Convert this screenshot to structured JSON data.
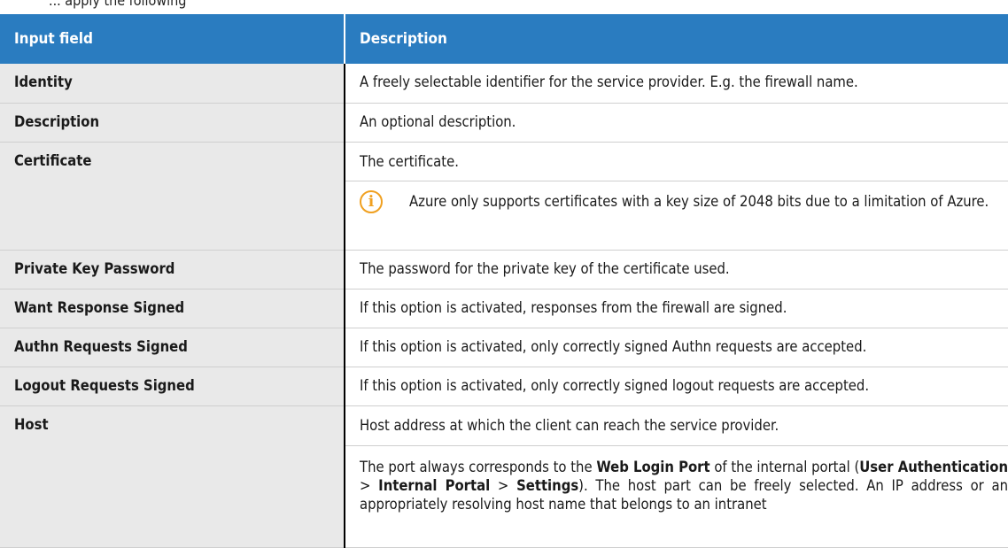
{
  "header_cut_text": "... apply the following",
  "columns": [
    "Input field",
    "Description"
  ],
  "rows": [
    {
      "label": "Identity",
      "desc": "A freely selectable identifier for the service provider. E.g. the firewall name."
    },
    {
      "label": "Description",
      "desc": "An optional description."
    },
    {
      "label": "Certificate",
      "desc": "The certificate.",
      "note_icon": "info-icon",
      "note": "Azure only supports certificates with a key size of 2048 bits due to a limitation of Azure."
    },
    {
      "label": "Private Key Password",
      "desc": "The password for the private key of the certificate used."
    },
    {
      "label": "Want Response Signed",
      "desc": "If this option is activated, responses from the firewall are signed."
    },
    {
      "label": "Authn Requests Signed",
      "desc": "If this option is activated, only correctly signed Authn requests are accepted."
    },
    {
      "label": "Logout Requests Signed",
      "desc": "If this option is activated, only correctly signed logout requests are accepted."
    },
    {
      "label": "Host",
      "desc": "Host address at which the client can reach the service provider.",
      "sub": {
        "t1": "The port always corresponds to the ",
        "b1": "Web Login Port",
        "t2": " of the internal portal (",
        "b2": "User Authentication",
        "t3": " > ",
        "b3": "Internal Portal",
        "t4": " > ",
        "b4": "Settings",
        "t5": "). The host part can be freely selected. An IP address or an appropriately resolving host name that belongs to an intranet"
      }
    }
  ]
}
